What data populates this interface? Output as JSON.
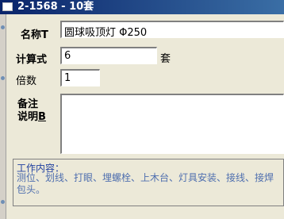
{
  "window": {
    "title": "2-1568 - 10套"
  },
  "form": {
    "name_label": "名称",
    "name_label_hotkey": "T",
    "name_value": "圆球吸顶灯  Φ250",
    "formula_label": "计算式",
    "formula_value": "6",
    "formula_unit": "套",
    "multiplier_label": "倍数",
    "multiplier_value": "1",
    "remark_label_line1": "备注",
    "remark_label_line2": "说明",
    "remark_label_hotkey": "B",
    "remark_value": ""
  },
  "work": {
    "title": "工作内容：",
    "text": "测位、划线、打眼、埋螺栓、上木台、灯具安装、接线、接焊包头。"
  }
}
